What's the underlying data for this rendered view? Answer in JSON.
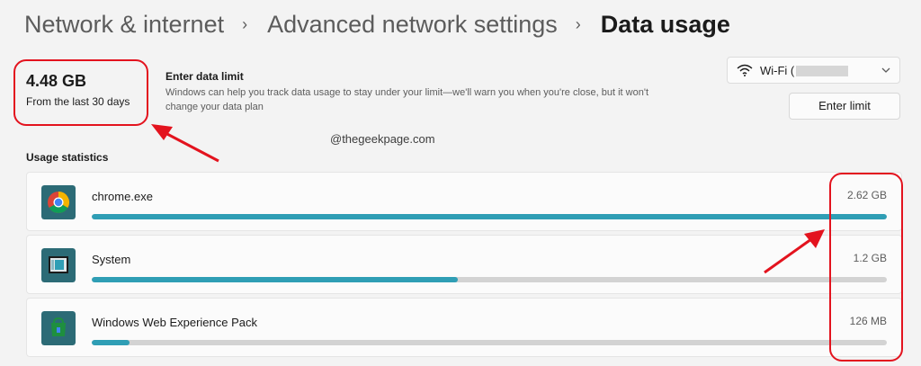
{
  "breadcrumb": [
    "Network & internet",
    "Advanced network settings",
    "Data usage"
  ],
  "summary": {
    "total": "4.48 GB",
    "caption": "From the last 30 days"
  },
  "data_limit": {
    "title": "Enter data limit",
    "description_line1": "Windows can help you track data usage to stay under your limit—we'll warn you when you're close, but it won't",
    "description_line2": "change your data plan",
    "button": "Enter limit"
  },
  "network": {
    "selected": "Wi-Fi (",
    "icon": "wifi-icon"
  },
  "watermark": "@thegeekpage.com",
  "usage_statistics": {
    "title": "Usage statistics",
    "apps": [
      {
        "name": "chrome.exe",
        "usage": "2.62 GB",
        "fraction": 1.0,
        "icon": "chrome-icon"
      },
      {
        "name": "System",
        "usage": "1.2 GB",
        "fraction": 0.46,
        "icon": "system-icon"
      },
      {
        "name": "Windows Web Experience Pack",
        "usage": "126 MB",
        "fraction": 0.048,
        "icon": "web-experience-icon"
      }
    ]
  },
  "colors": {
    "accent": "#2f9eb5",
    "annotation": "#e3131e",
    "track": "#d3d3d3"
  }
}
